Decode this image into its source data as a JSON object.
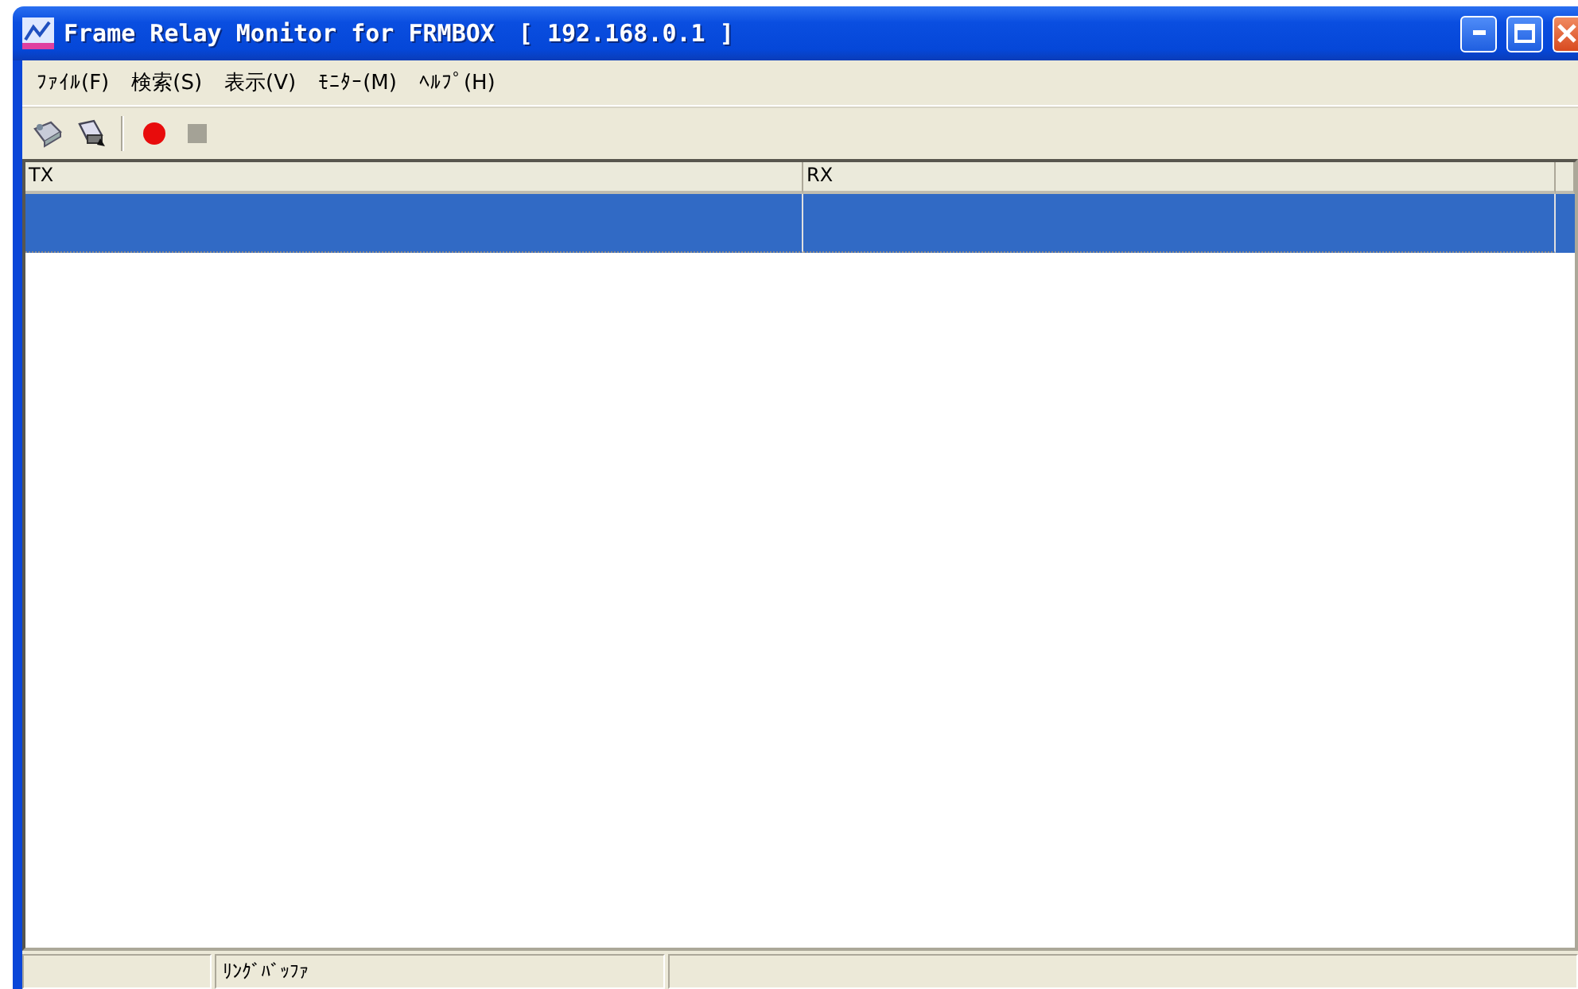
{
  "window": {
    "title": "Frame Relay Monitor for FRMBOX　[ 192.168.0.1 ]"
  },
  "menu": [
    {
      "label": "ﾌｧｲﾙ(F)"
    },
    {
      "label": "検索(S)"
    },
    {
      "label": "表示(V)"
    },
    {
      "label": "ﾓﾆﾀｰ(M)"
    },
    {
      "label": "ﾍﾙﾌﾟ(H)"
    }
  ],
  "toolbar": [
    {
      "kind": "device",
      "disabled": false
    },
    {
      "kind": "scanner",
      "disabled": false
    },
    {
      "kind": "separator"
    },
    {
      "kind": "record",
      "disabled": false
    },
    {
      "kind": "stop",
      "disabled": true
    }
  ],
  "table": {
    "columns": [
      "TX",
      "RX"
    ],
    "rows": [
      {
        "selected": true
      }
    ]
  },
  "status_bar": {
    "text": "ﾘﾝｸﾞﾊﾞｯﾌｧ"
  }
}
